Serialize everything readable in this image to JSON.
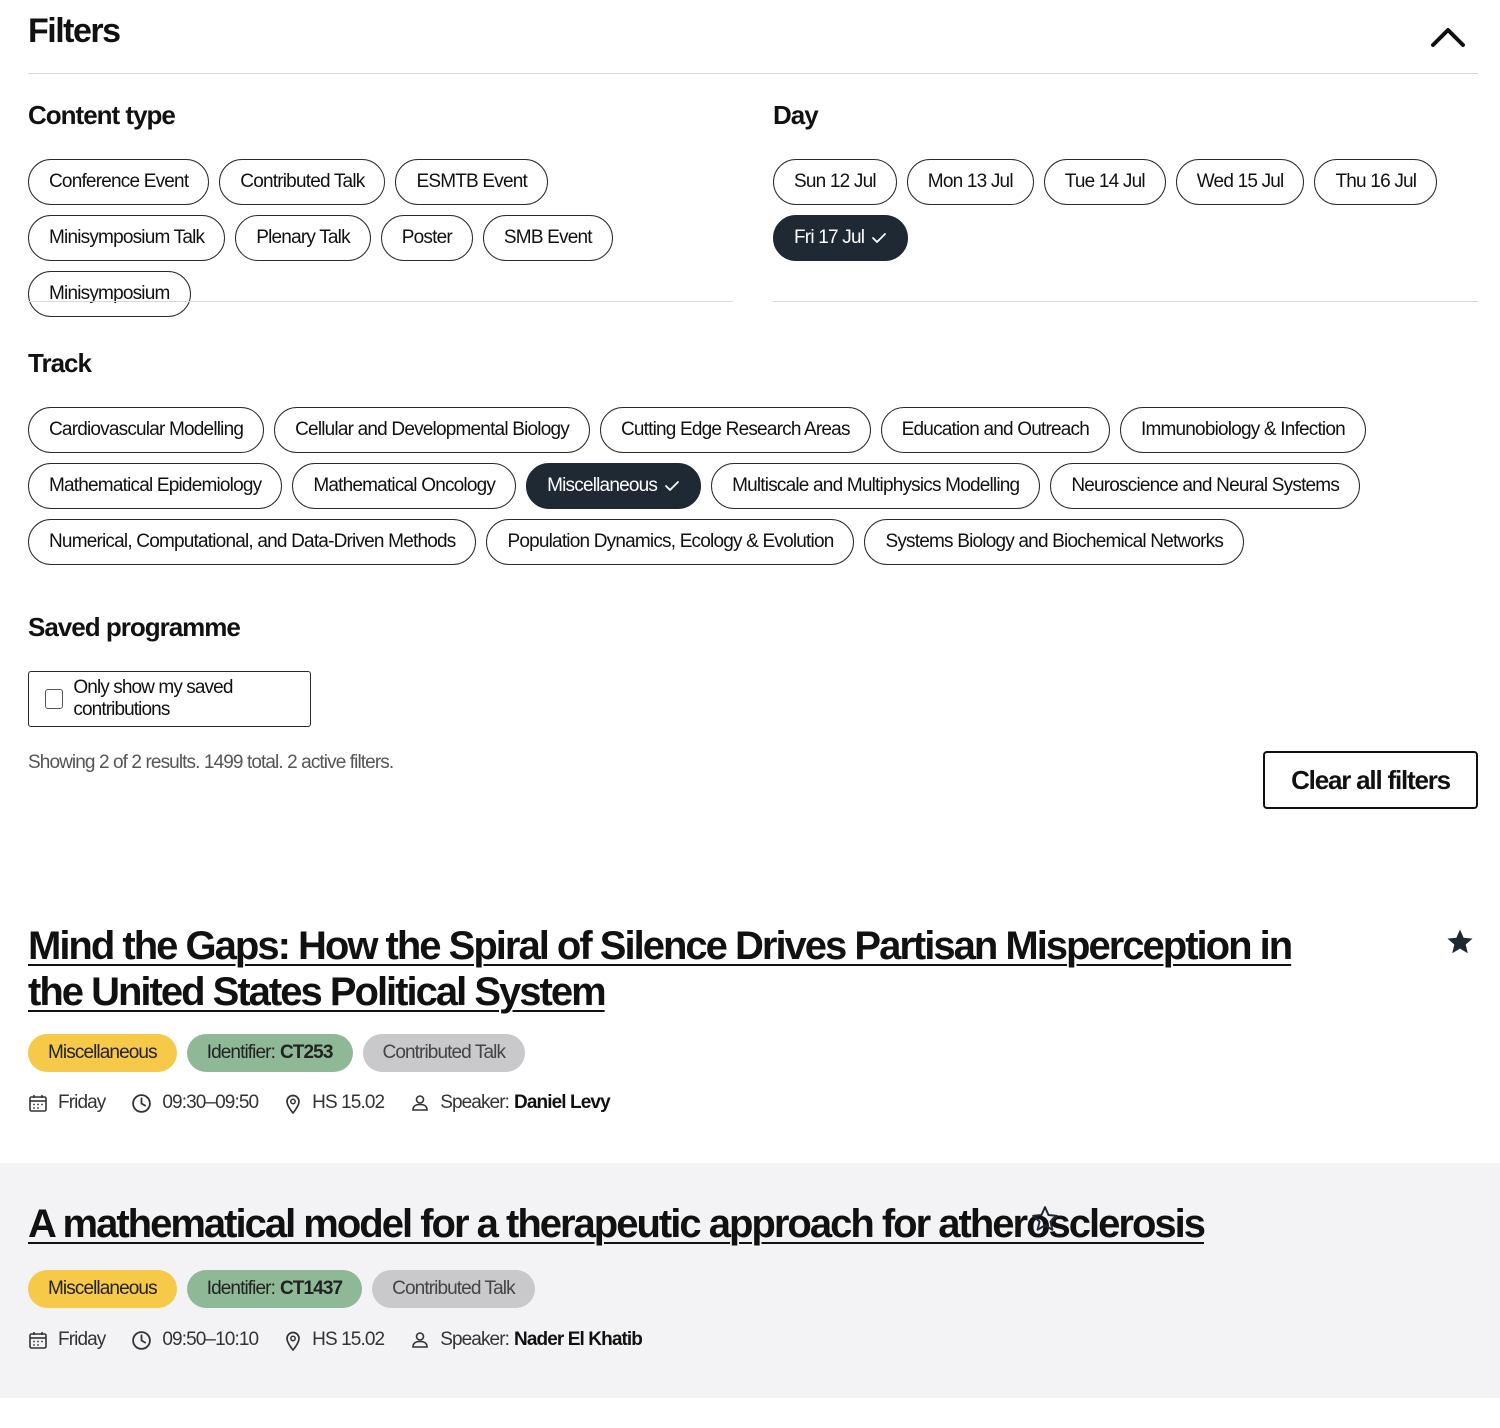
{
  "filters": {
    "title": "Filters"
  },
  "content_type": {
    "title": "Content type",
    "chips": [
      {
        "label": "Conference Event"
      },
      {
        "label": "Contributed Talk"
      },
      {
        "label": "ESMTB Event"
      },
      {
        "label": "Minisymposium Talk"
      },
      {
        "label": "Plenary Talk"
      },
      {
        "label": "Poster"
      },
      {
        "label": "SMB Event"
      },
      {
        "label": "Minisymposium"
      }
    ]
  },
  "day": {
    "title": "Day",
    "chips": [
      {
        "label": "Sun 12 Jul"
      },
      {
        "label": "Mon 13 Jul"
      },
      {
        "label": "Tue 14 Jul"
      },
      {
        "label": "Wed 15 Jul"
      },
      {
        "label": "Thu 16 Jul"
      },
      {
        "label": "Fri 17 Jul",
        "selected": true
      }
    ]
  },
  "track": {
    "title": "Track",
    "chips": [
      {
        "label": "Cardiovascular Modelling"
      },
      {
        "label": "Cellular and Developmental Biology"
      },
      {
        "label": "Cutting Edge Research Areas"
      },
      {
        "label": "Education and Outreach"
      },
      {
        "label": "Immunobiology & Infection"
      },
      {
        "label": "Mathematical Epidemiology"
      },
      {
        "label": "Mathematical Oncology"
      },
      {
        "label": "Miscellaneous",
        "selected": true
      },
      {
        "label": "Multiscale and Multiphysics Modelling"
      },
      {
        "label": "Neuroscience and Neural Systems"
      },
      {
        "label": "Numerical, Computational, and Data-Driven Methods"
      },
      {
        "label": "Population Dynamics, Ecology & Evolution"
      },
      {
        "label": "Systems Biology and Biochemical Networks"
      }
    ]
  },
  "saved": {
    "title": "Saved programme",
    "checkbox_label": "Only show my saved contributions",
    "checked": false
  },
  "results_summary": "Showing 2 of 2 results. 1499 total. 2 active filters.",
  "clear_label": "Clear all filters",
  "results": [
    {
      "title": "Mind the Gaps: How the Spiral of Silence Drives Partisan Misperception in the United States Political System",
      "saved": true,
      "track": "Miscellaneous",
      "identifier_label": "Identifier:",
      "identifier": "CT253",
      "type": "Contributed Talk",
      "day": "Friday",
      "time": "09:30–09:50",
      "room": "HS 15.02",
      "speaker_label": "Speaker:",
      "speaker": "Daniel Levy"
    },
    {
      "title": "A mathematical model for a therapeutic approach for atherosclerosis",
      "saved": false,
      "track": "Miscellaneous",
      "identifier_label": "Identifier:",
      "identifier": "CT1437",
      "type": "Contributed Talk",
      "day": "Friday",
      "time": "09:50–10:10",
      "room": "HS 15.02",
      "speaker_label": "Speaker:",
      "speaker": "Nader El Khatib"
    }
  ],
  "icons": {
    "collapse": "chevron-up-icon",
    "check": "check-icon",
    "star_filled": "star-filled-icon",
    "star_outline": "star-outline-icon",
    "calendar": "calendar-icon",
    "clock": "clock-icon",
    "location": "location-pin-icon",
    "speaker": "person-icon"
  },
  "colors": {
    "selected_chip": "#1f2933",
    "tag_track": "#f7c948",
    "tag_identifier": "#8fb996",
    "tag_type": "#c9c9cc",
    "alt_row": "#f3f3f5"
  }
}
